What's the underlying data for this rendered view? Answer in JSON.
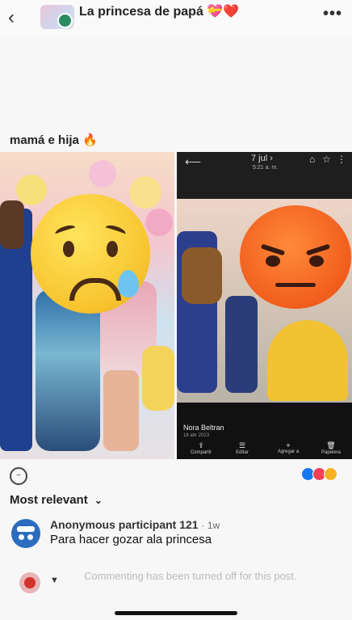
{
  "header": {
    "title": "La princesa de papá 💝❤️",
    "back_icon": "‹",
    "more_icon": "•••"
  },
  "post": {
    "caption": "mamá e hija 🔥"
  },
  "right_photo": {
    "date": "7 jul ›",
    "time": "5:21 a. m.",
    "owner_name": "Nora Beltran",
    "owner_sub": "18 abr 2023",
    "actions": [
      {
        "label": "Compartir",
        "icon": "share-icon"
      },
      {
        "label": "Editar",
        "icon": "edit-icon"
      },
      {
        "label": "Agregar a",
        "icon": "plus-icon"
      },
      {
        "label": "Papelera",
        "icon": "trash-icon"
      }
    ]
  },
  "reactions": {
    "colors": [
      "#1877f2",
      "#f33e58",
      "#f7b125"
    ]
  },
  "comments": {
    "sort_label": "Most relevant",
    "items": [
      {
        "author": "Anonymous participant 121",
        "age": "1w",
        "text": "Para hacer gozar ala princesa"
      }
    ]
  },
  "composer": {
    "disabled_text": "Commenting has been turned off for this post."
  }
}
